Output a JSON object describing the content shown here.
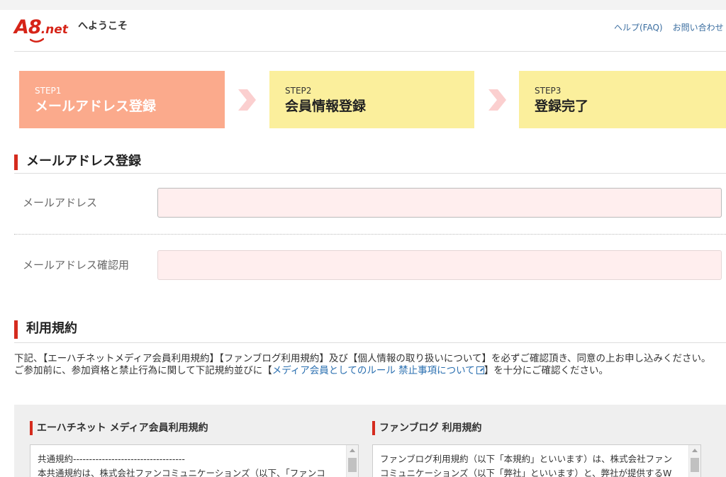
{
  "header": {
    "logo_text_main": "A8",
    "logo_text_suffix": ".net",
    "welcome": "へようこそ",
    "links": [
      "ヘルプ(FAQ)",
      "お問い合わせ"
    ]
  },
  "steps": [
    {
      "num": "STEP1",
      "title": "メールアドレス登録",
      "state": "current"
    },
    {
      "num": "STEP2",
      "title": "会員情報登録",
      "state": "upcoming"
    },
    {
      "num": "STEP3",
      "title": "登録完了",
      "state": "upcoming"
    }
  ],
  "email_section": {
    "title": "メールアドレス登録",
    "email_label": "メールアドレス",
    "email_value": "",
    "confirm_label": "メールアドレス確認用",
    "confirm_value": ""
  },
  "terms_section": {
    "title": "利用規約",
    "intro_line1": "下記、【エーハチネットメディア会員利用規約】【ファンブログ利用規約】及び【個人情報の取り扱いについて】を必ずご確認頂き、同意の上お申し込みください。",
    "intro_line2_before": "ご参加前に、参加資格と禁止行為に関して下記規約並びに【",
    "intro_link": "メディア会員としてのルール 禁止事項について",
    "intro_line2_after": "】を十分にご確認ください。",
    "box1_title": "エーハチネット メディア会員利用規約",
    "box1_content": "共通規約-----------------------------------\n本共通規約は、株式会社ファンコミュニケーションズ（以下、「ファンコ",
    "box2_title": "ファンブログ 利用規約",
    "box2_content": "ファンブログ利用規約（以下「本規約」といいます）は、株式会社ファン\nコミュニケーションズ（以下「弊社」といいます）と、弊社が提供するW"
  },
  "colors": {
    "step_current": "#fbaa8c",
    "step_upcoming": "#fbef9c",
    "arrow": "#fbcfcf",
    "accent_red": "#d52b1e",
    "input_bg": "#ffeeee",
    "link": "#2a6fb0"
  }
}
